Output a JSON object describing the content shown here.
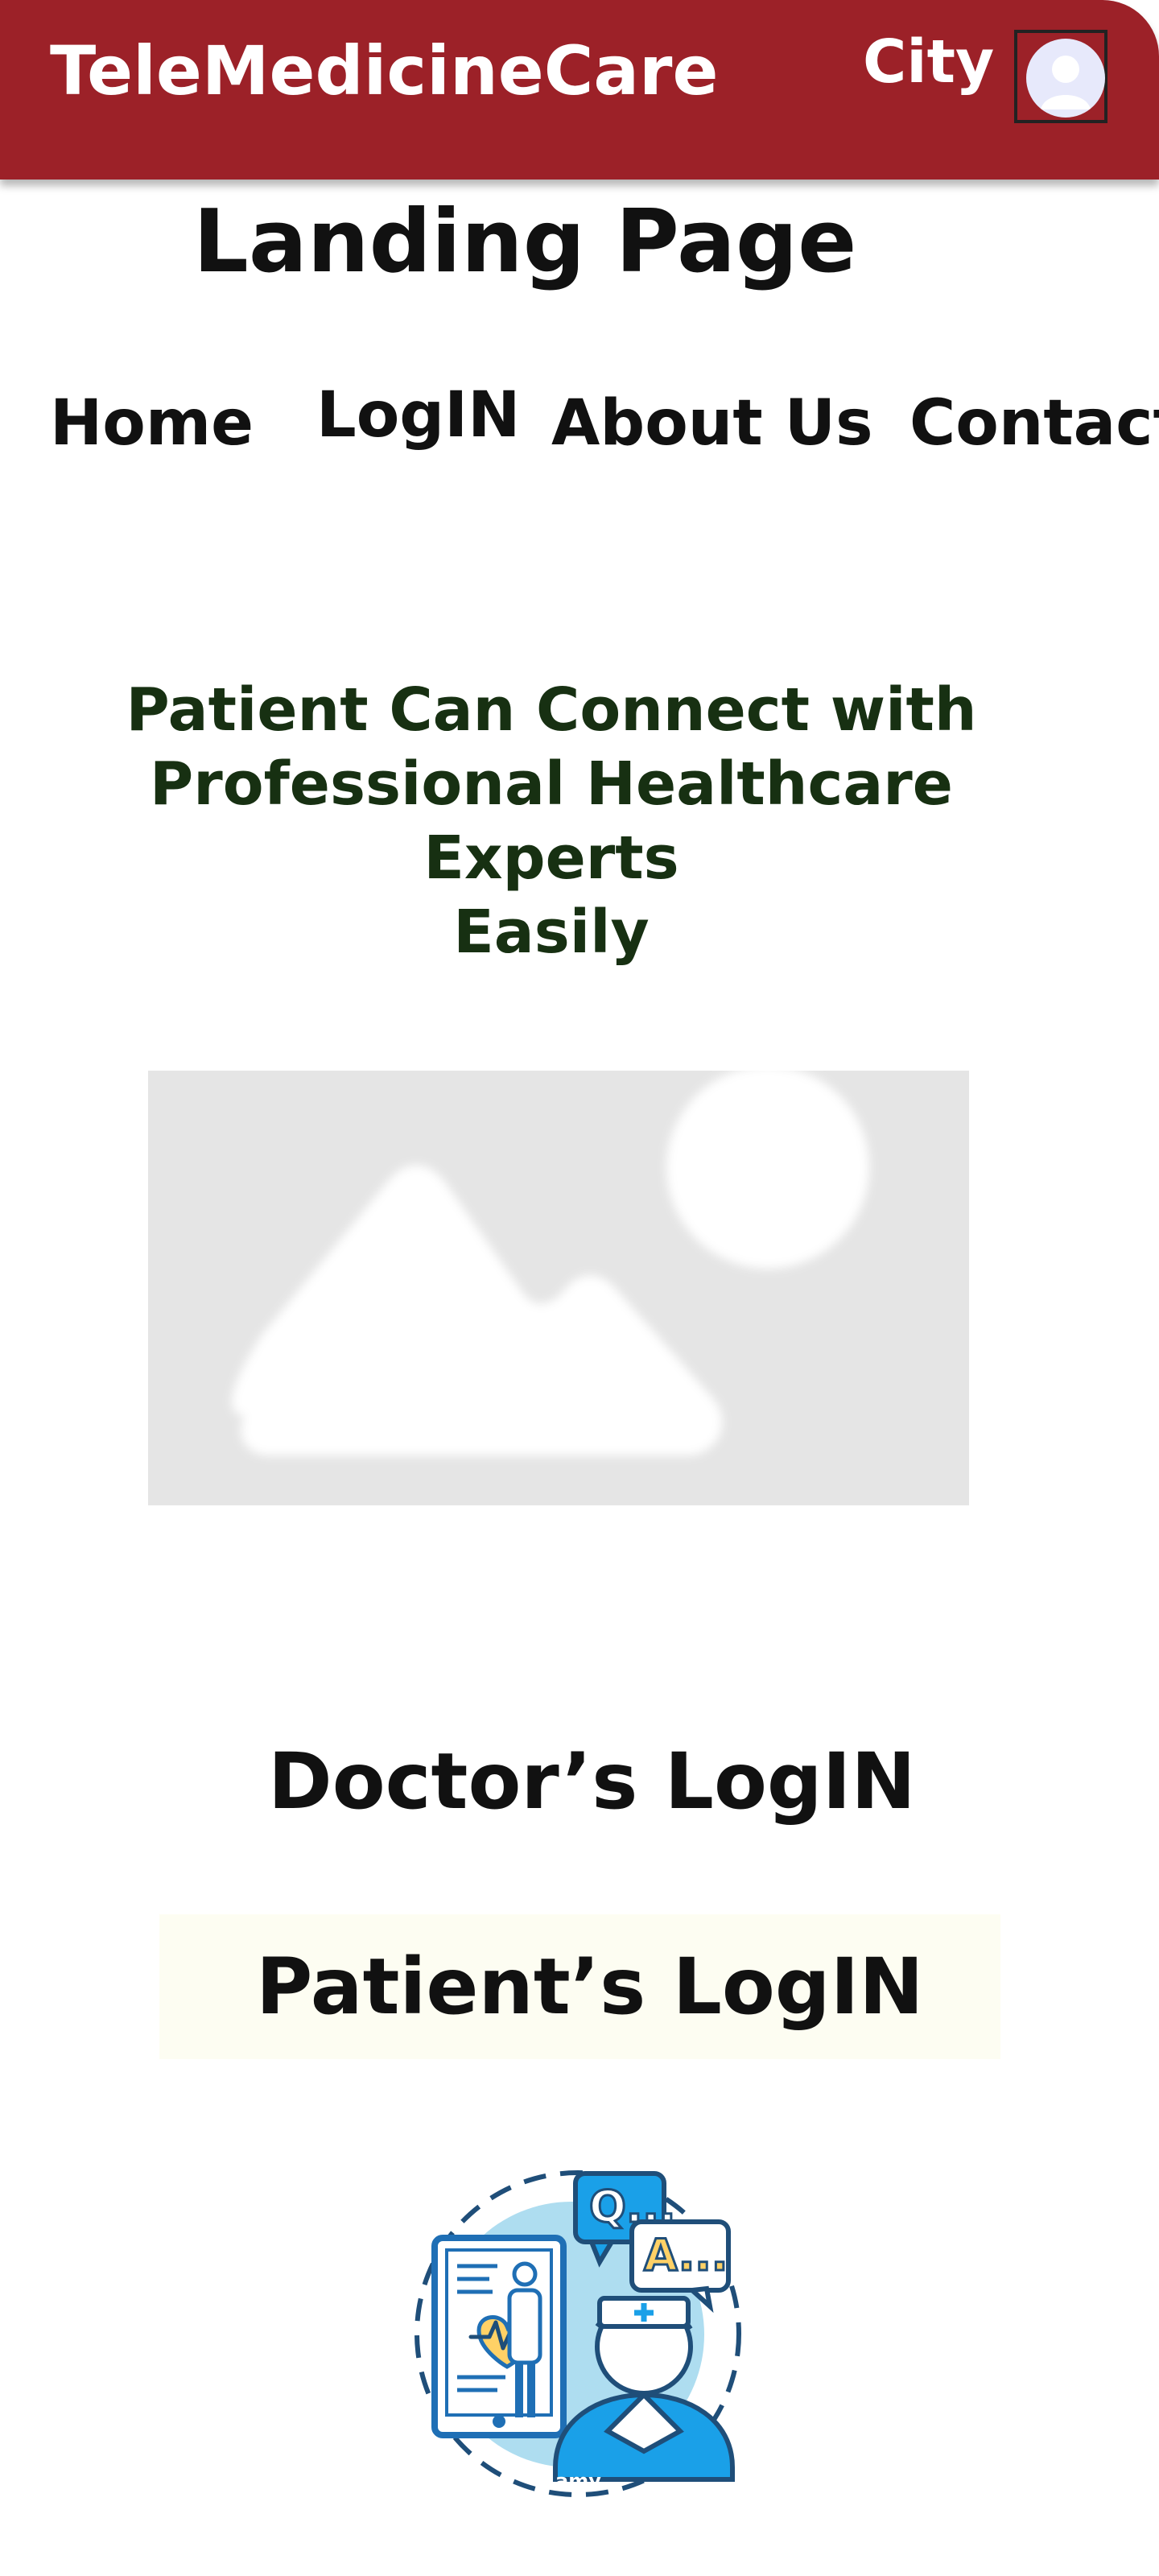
{
  "header": {
    "brand": "TeleMedicineCare",
    "city": "City",
    "avatar_icon": "user-avatar-icon",
    "background_color": "#9c2128"
  },
  "page": {
    "title": "Landing Page"
  },
  "nav": {
    "items": [
      {
        "label": "Home"
      },
      {
        "label": "LogIN"
      },
      {
        "label": "About Us"
      },
      {
        "label": "Contact"
      }
    ]
  },
  "hero": {
    "lines": [
      "Patient Can Connect with",
      "Professional Healthcare Experts",
      "Easily"
    ],
    "color": "#173012"
  },
  "media": {
    "placeholder_icon": "image-placeholder-icon"
  },
  "auth": {
    "doctor_login": "Doctor’s LogIN",
    "patient_login": "Patient’s LogIN",
    "patient_box_color": "#fdfdf2"
  },
  "illustration": {
    "icon": "telemedicine-qa-icon",
    "q_text": "Q...",
    "a_text": "A...",
    "watermark": "amy"
  }
}
